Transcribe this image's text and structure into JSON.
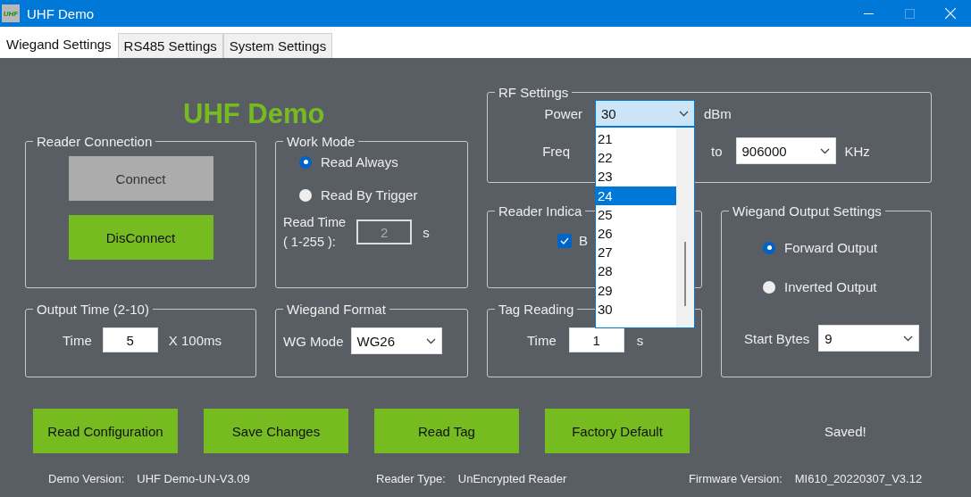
{
  "window": {
    "title": "UHF Demo",
    "icon_text": "UHF"
  },
  "tabs": [
    {
      "label": "Wiegand Settings",
      "selected": true
    },
    {
      "label": "RS485 Settings",
      "selected": false
    },
    {
      "label": "System Settings",
      "selected": false
    }
  ],
  "logo": "UHF Demo",
  "reader_connection": {
    "title": "Reader Connection",
    "buttons": [
      {
        "label": "Connect",
        "disabled": true
      },
      {
        "label": "DisConnect",
        "disabled": false
      }
    ]
  },
  "work_mode": {
    "title": "Work Mode",
    "options": [
      {
        "label": "Read Always",
        "selected": true
      },
      {
        "label": "Read By Trigger",
        "selected": false
      }
    ],
    "read_time_label": "Read Time",
    "read_time_range": "( 1-255 ):",
    "read_time_value": "2",
    "read_time_disabled": true,
    "read_time_unit": "s"
  },
  "output_time": {
    "title": "Output Time (2-10)",
    "label": "Time",
    "value": "5",
    "unit": "X 100ms"
  },
  "wiegand_format": {
    "title": "Wiegand Format",
    "label": "WG Mode",
    "value": "WG26"
  },
  "rf_settings": {
    "title": "RF Settings",
    "power_label": "Power",
    "power_value": "30",
    "power_unit": "dBm",
    "power_open": true,
    "power_options": [
      {
        "label": "21",
        "selected": false
      },
      {
        "label": "22",
        "selected": false
      },
      {
        "label": "23",
        "selected": false
      },
      {
        "label": "24",
        "selected": true
      },
      {
        "label": "25",
        "selected": false
      },
      {
        "label": "26",
        "selected": false
      },
      {
        "label": "27",
        "selected": false
      },
      {
        "label": "28",
        "selected": false
      },
      {
        "label": "29",
        "selected": false
      },
      {
        "label": "30",
        "selected": false
      }
    ],
    "freq_label": "Freq",
    "to_label": "to",
    "freq_to_value": "906000",
    "freq_unit": "KHz"
  },
  "reader_indicator": {
    "title": "Reader Indica",
    "checkbox": {
      "label": "B",
      "checked": true
    }
  },
  "tag_reading": {
    "title": "Tag Reading",
    "label": "Time",
    "value": "1",
    "unit": "s"
  },
  "wiegand_output": {
    "title": "Wiegand Output Settings",
    "options": [
      {
        "label": "Forward Output",
        "selected": true
      },
      {
        "label": "Inverted Output",
        "selected": false
      }
    ],
    "start_bytes_label": "Start Bytes",
    "start_bytes_value": "9"
  },
  "actions": [
    {
      "label": "Read Configuration"
    },
    {
      "label": "Save Changes"
    },
    {
      "label": "Read Tag"
    },
    {
      "label": "Factory Default"
    }
  ],
  "status": "Saved!",
  "footer": [
    {
      "label": "Demo Version:",
      "value": "UHF Demo-UN-V3.09"
    },
    {
      "label": "Reader Type:",
      "value": "UnEncrypted Reader"
    },
    {
      "label": "Firmware Version:",
      "value": "MI610_20220307_V3.12"
    }
  ]
}
